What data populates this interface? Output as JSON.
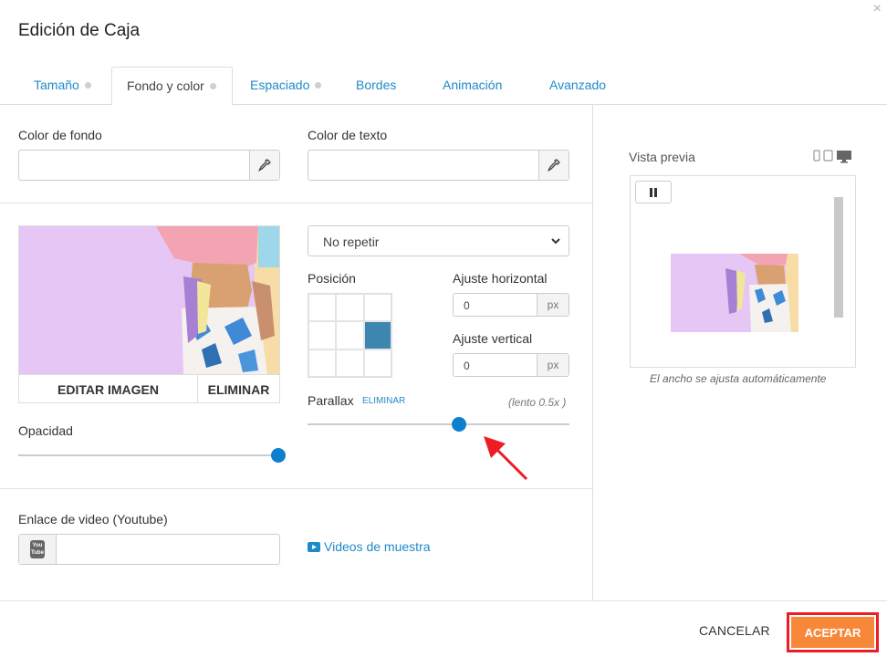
{
  "dialog": {
    "title": "Edición de Caja",
    "close_icon": "×"
  },
  "tabs": [
    {
      "label": "Tamaño",
      "dot": true
    },
    {
      "label": "Fondo y color",
      "dot": true,
      "active": true
    },
    {
      "label": "Espaciado",
      "dot": true
    },
    {
      "label": "Bordes",
      "dot": false
    },
    {
      "label": "Animación",
      "dot": false
    },
    {
      "label": "Avanzado",
      "dot": false
    }
  ],
  "colors": {
    "background_label": "Color de fondo",
    "background_value": "",
    "text_label": "Color de texto",
    "text_value": "",
    "picker_icon": "eyedropper-icon"
  },
  "image": {
    "edit_label": "EDITAR IMAGEN",
    "delete_label": "ELIMINAR"
  },
  "opacity": {
    "label": "Opacidad",
    "value": 1.0
  },
  "repeat": {
    "selected": "No repetir"
  },
  "position": {
    "label": "Posición",
    "selected_cell": 5
  },
  "offsets": {
    "horizontal_label": "Ajuste horizontal",
    "horizontal_value": "0",
    "vertical_label": "Ajuste vertical",
    "vertical_value": "0",
    "unit": "px"
  },
  "parallax": {
    "label": "Parallax",
    "remove_label": "ELIMINAR",
    "speed_note": "(lento 0.5x )",
    "value": 0.58
  },
  "video": {
    "label": "Enlace de video (Youtube)",
    "value": "",
    "icon_top": "You",
    "icon_bottom": "Tube",
    "samples_link": "Videos de muestra"
  },
  "preview": {
    "title": "Vista previa",
    "note": "El ancho se ajusta automáticamente"
  },
  "footer": {
    "cancel_label": "CANCELAR",
    "accept_label": "ACEPTAR"
  },
  "accent_colors": {
    "link": "#1f8ac9",
    "slider": "#0d7fcc",
    "accept": "#f7883a",
    "highlight": "#ee1c25"
  }
}
